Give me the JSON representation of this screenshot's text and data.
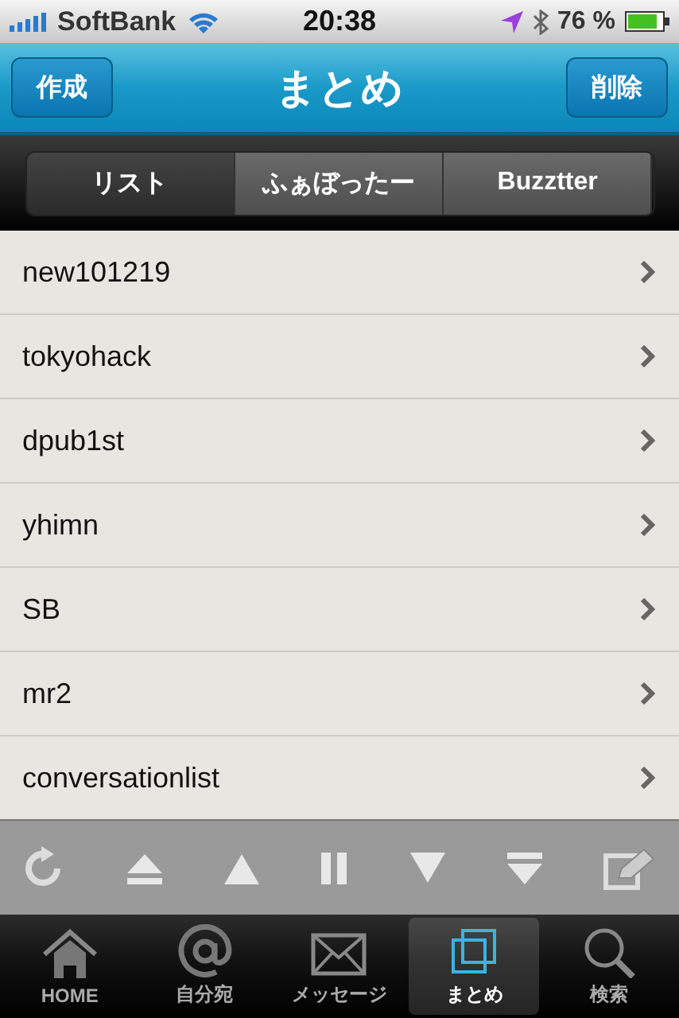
{
  "status_bar": {
    "carrier": "SoftBank",
    "time": "20:38",
    "battery": "76 %"
  },
  "nav_bar": {
    "title": "まとめ",
    "left_button": "作成",
    "right_button": "削除"
  },
  "segments": [
    {
      "label": "リスト",
      "selected": true
    },
    {
      "label": "ふぁぼったー",
      "selected": false
    },
    {
      "label": "Buzztter",
      "selected": false
    }
  ],
  "list": [
    "new101219",
    "tokyohack",
    "dpub1st",
    "yhimn",
    "SB",
    "mr2",
    "conversationlist"
  ],
  "tab_bar": [
    {
      "label": "HOME",
      "kind": "home",
      "selected": false
    },
    {
      "label": "自分宛",
      "kind": "mentions",
      "selected": false
    },
    {
      "label": "メッセージ",
      "kind": "messages",
      "selected": false
    },
    {
      "label": "まとめ",
      "kind": "lists",
      "selected": true
    },
    {
      "label": "検索",
      "kind": "search",
      "selected": false
    }
  ]
}
